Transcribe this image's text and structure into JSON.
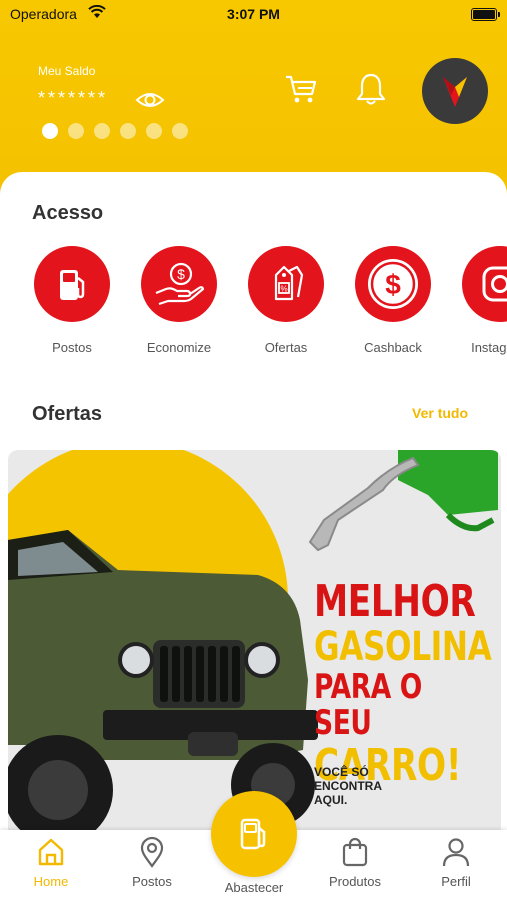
{
  "status_bar": {
    "carrier": "Operadora",
    "time": "3:07 PM"
  },
  "header": {
    "balance_label": "Meu Saldo",
    "balance_value": "*******",
    "icons": [
      "eye-icon",
      "cart-icon",
      "bell-icon",
      "avatar"
    ],
    "carousel": {
      "count": 6,
      "active_index": 0
    },
    "colors": {
      "background": "#f6c400",
      "avatar_bg": "#3a3a3a"
    }
  },
  "access": {
    "title": "Acesso",
    "items": [
      {
        "label": "Postos",
        "icon": "fuel-pump-icon"
      },
      {
        "label": "Economize",
        "icon": "hand-money-icon"
      },
      {
        "label": "Ofertas",
        "icon": "price-tags-icon"
      },
      {
        "label": "Cashback",
        "icon": "dollar-coin-icon"
      },
      {
        "label": "Instagram",
        "icon": "instagram-icon"
      }
    ],
    "accent_color": "#e3141b"
  },
  "offers": {
    "title": "Ofertas",
    "see_all": "Ver tudo",
    "banner": {
      "line1": "MELHOR",
      "line2": "GASOLINA",
      "line3": "PARA O SEU",
      "line4": "CARRO!",
      "small_line1": "VOCÊ SÓ",
      "small_line2": "ENCONTRA",
      "small_line3": "AQUI."
    }
  },
  "bottom_nav": {
    "items": [
      {
        "label": "Home",
        "icon": "home-icon",
        "active": true
      },
      {
        "label": "Postos",
        "icon": "location-pin-icon",
        "active": false
      },
      {
        "label": "Abastecer",
        "icon": "fuel-pump-icon",
        "active": false
      },
      {
        "label": "Produtos",
        "icon": "shopping-bag-icon",
        "active": false
      },
      {
        "label": "Perfil",
        "icon": "user-icon",
        "active": false
      }
    ],
    "active_color": "#f2b900"
  }
}
